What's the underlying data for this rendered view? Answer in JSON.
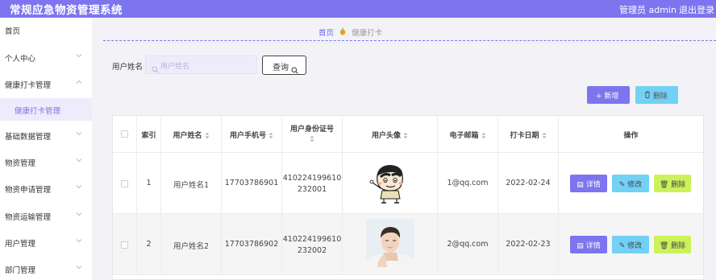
{
  "app": {
    "title": "常规应急物资管理系统",
    "admin": "管理员 admin",
    "logout": "退出登录"
  },
  "sidebar": {
    "home": "首页",
    "items": [
      {
        "label": "个人中心"
      },
      {
        "label": "健康打卡管理"
      },
      {
        "label": "基础数据管理"
      },
      {
        "label": "物资管理"
      },
      {
        "label": "物资申请管理"
      },
      {
        "label": "物资运输管理"
      },
      {
        "label": "用户管理"
      },
      {
        "label": "部门管理"
      }
    ],
    "sub_active": "健康打卡管理"
  },
  "breadcrumb": {
    "home": "首页",
    "current": "健康打卡"
  },
  "search": {
    "label": "用户姓名",
    "placeholder": "用户姓名",
    "button": "查询"
  },
  "toolbar": {
    "add": "新增",
    "delete": "删除"
  },
  "table": {
    "headers": [
      "索引",
      "用户姓名",
      "用户手机号",
      "用户身份证号",
      "用户头像",
      "电子邮箱",
      "打卡日期",
      "操作"
    ],
    "rows": [
      {
        "index": "1",
        "name": "用户姓名1",
        "phone": "17703786901",
        "id_line1": "410224199610",
        "id_line2": "232001",
        "email": "1@qq.com",
        "date": "2022-02-24"
      },
      {
        "index": "2",
        "name": "用户姓名2",
        "phone": "17703786902",
        "id_line1": "410224199610",
        "id_line2": "232002",
        "email": "2@qq.com",
        "date": "2022-02-23"
      }
    ],
    "actions": {
      "detail": "详情",
      "edit": "修改",
      "delete": "删除"
    }
  },
  "colors": {
    "primary": "#7c75ef",
    "info": "#72d1f5",
    "lime": "#ccf25a"
  }
}
